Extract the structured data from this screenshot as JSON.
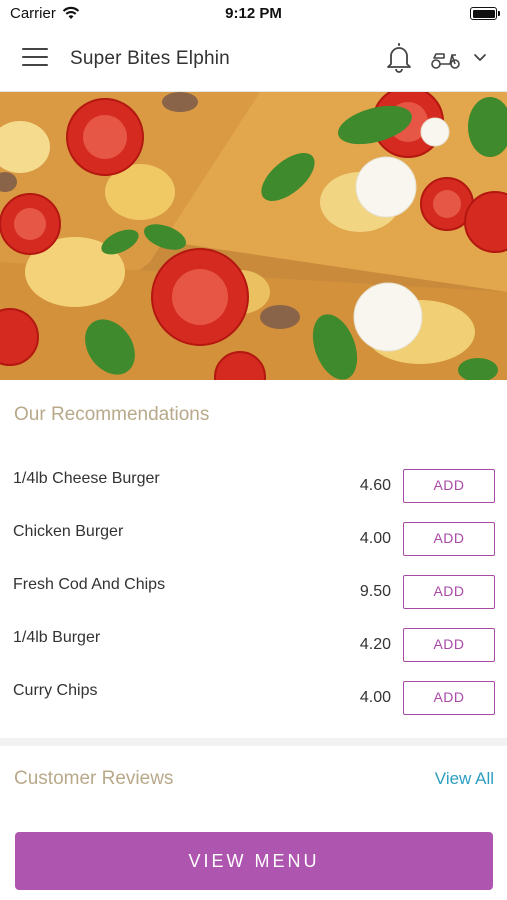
{
  "status_bar": {
    "carrier": "Carrier",
    "time": "9:12 PM",
    "battery_level": 1.0
  },
  "header": {
    "title": "Super Bites Elphin",
    "icons": [
      "menu-icon",
      "bell-icon",
      "scooter-icon",
      "chevron-down-icon"
    ]
  },
  "hero": {
    "image": "pizza-photo"
  },
  "recommendations": {
    "title": "Our Recommendations",
    "items": [
      {
        "name": "1/4lb Cheese Burger",
        "price": "4.60",
        "action": "ADD"
      },
      {
        "name": "Chicken Burger",
        "price": "4.00",
        "action": "ADD"
      },
      {
        "name": "Fresh Cod And Chips",
        "price": "9.50",
        "action": "ADD"
      },
      {
        "name": "1/4lb Burger",
        "price": "4.20",
        "action": "ADD"
      },
      {
        "name": "Curry Chips",
        "price": "4.00",
        "action": "ADD"
      }
    ]
  },
  "reviews": {
    "title": "Customer Reviews",
    "view_all": "View All"
  },
  "footer": {
    "view_menu": "VIEW MENU"
  },
  "colors": {
    "accent": "#ae55b0",
    "section_title": "#b8a98a",
    "link": "#2e9ec0"
  }
}
